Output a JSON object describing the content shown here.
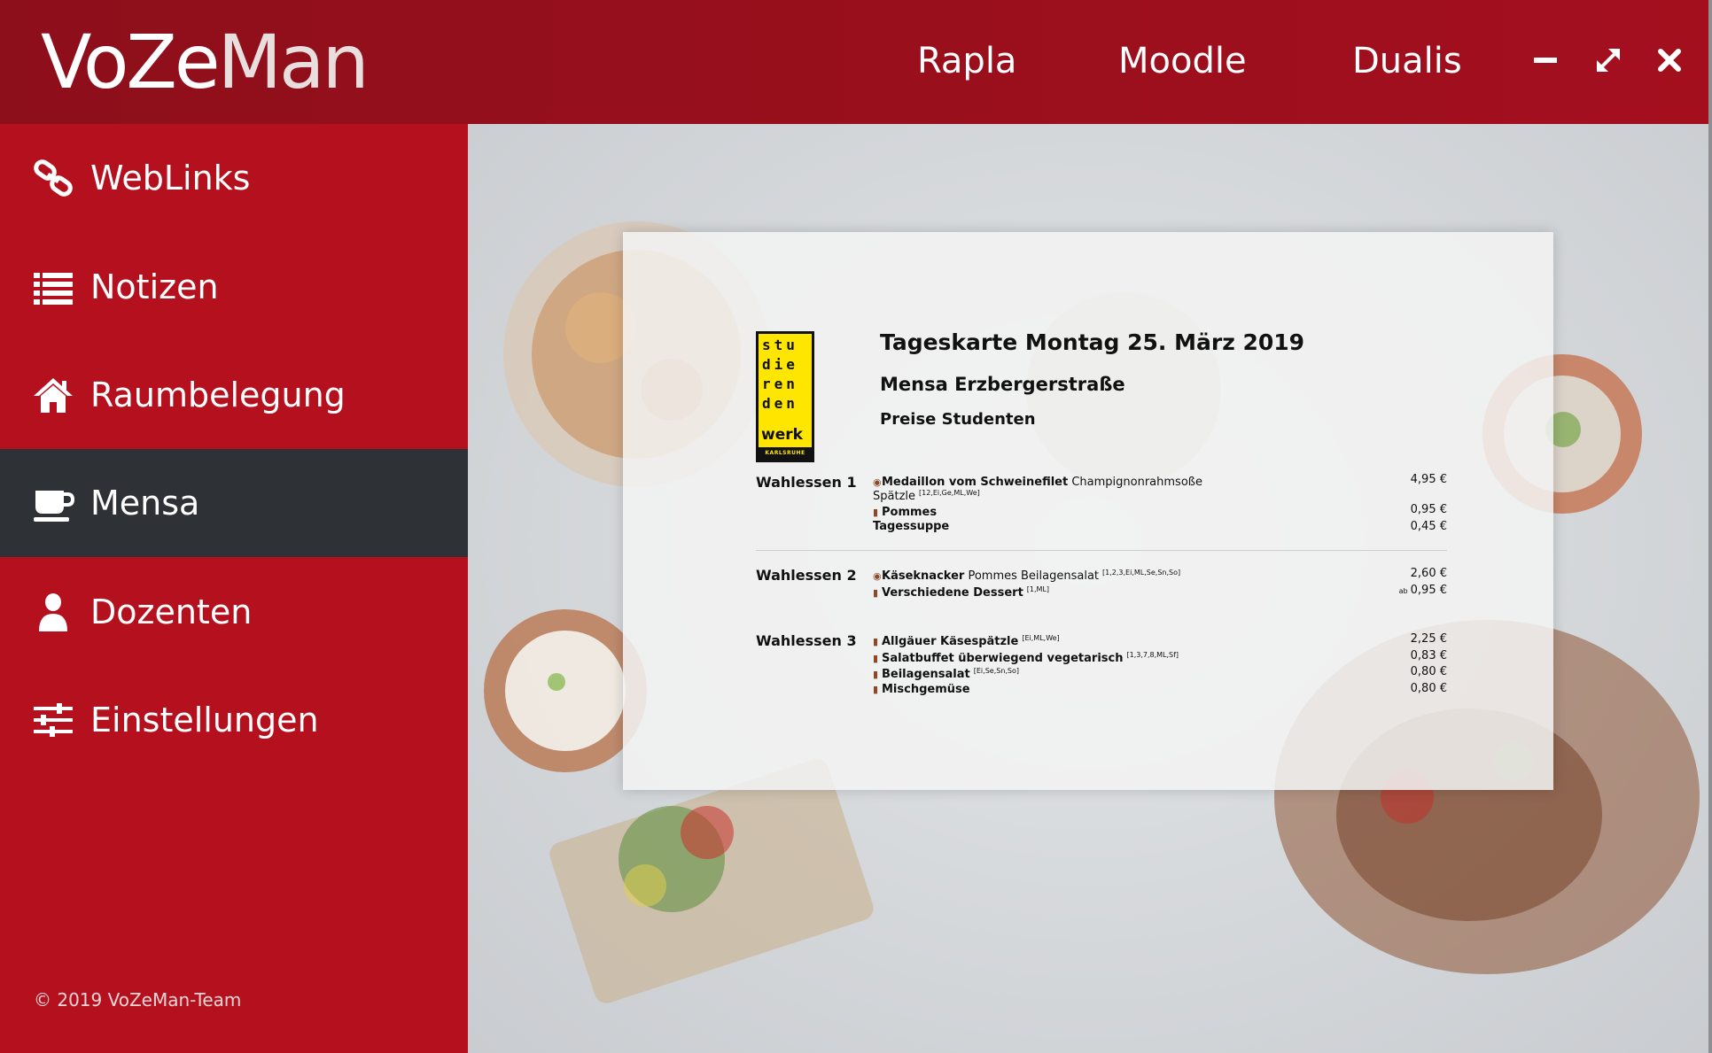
{
  "header": {
    "logo_part1": "VoZe",
    "logo_part2": "Man",
    "nav": [
      "Rapla",
      "Moodle",
      "Dualis"
    ],
    "window_controls": [
      "minimize-icon",
      "maximize-icon",
      "close-icon"
    ]
  },
  "sidebar": {
    "items": [
      {
        "label": "WebLinks",
        "icon": "link-icon"
      },
      {
        "label": "Notizen",
        "icon": "list-icon"
      },
      {
        "label": "Raumbelegung",
        "icon": "home-icon"
      },
      {
        "label": "Mensa",
        "icon": "coffee-cup-icon",
        "active": true
      },
      {
        "label": "Dozenten",
        "icon": "user-icon"
      },
      {
        "label": "Einstellungen",
        "icon": "sliders-icon"
      }
    ],
    "copyright": "© 2019 VoZeMan-Team"
  },
  "menu": {
    "logo": {
      "rows": [
        "stu",
        "die",
        "ren",
        "den"
      ],
      "werk": "werk",
      "city": "KARLSRUHE"
    },
    "title": "Tageskarte Montag 25. März 2019",
    "location": "Mensa Erzbergerstraße",
    "price_group": "Preise Studenten",
    "sections": [
      {
        "label": "Wahlessen 1",
        "items": [
          {
            "name": "Medaillon vom Schweinefilet",
            "desc": "Champignonrahmsoße",
            "price": "4,95 €"
          },
          {
            "name": "",
            "desc": "Spätzle",
            "allergens": "[12,Ei,Ge,ML,We]",
            "price": ""
          },
          {
            "name": "Pommes",
            "desc": "",
            "price": "0,95 €"
          },
          {
            "name": "Tagessuppe",
            "desc": "",
            "price": "0,45 €"
          }
        ]
      },
      {
        "label": "Wahlessen 2",
        "items": [
          {
            "name": "Käseknacker",
            "desc": "Pommes Beilagensalat",
            "allergens": "[1,2,3,Ei,ML,Se,Sn,So]",
            "price": "2,60 €"
          },
          {
            "name": "Verschiedene Dessert",
            "desc": "",
            "allergens": "[1,ML]",
            "price": "0,95 €",
            "price_prefix": "ab"
          }
        ]
      },
      {
        "label": "Wahlessen 3",
        "items": [
          {
            "name": "Allgäuer Käsespätzle",
            "desc": "",
            "allergens": "[Ei,ML,We]",
            "price": "2,25 €"
          },
          {
            "name": "Salatbuffet überwiegend vegetarisch",
            "desc": "",
            "allergens": "[1,3,7,8,ML,Sf]",
            "price": "0,83 €"
          },
          {
            "name": "Beilagensalat",
            "desc": "",
            "allergens": "[Ei,Se,Sn,So]",
            "price": "0,80 €"
          },
          {
            "name": "Mischgemüse",
            "desc": "",
            "price": "0,80 €"
          }
        ]
      }
    ]
  },
  "colors": {
    "header_red": "#9a0f1c",
    "sidebar_red": "#b5101d",
    "active_dark": "#2e3135",
    "logo_yellow": "#ffe600"
  }
}
